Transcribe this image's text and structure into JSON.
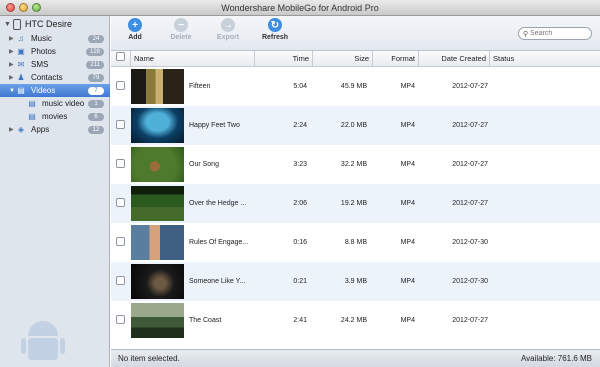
{
  "window": {
    "title": "Wondershare MobileGo for Android Pro"
  },
  "sidebar": {
    "device_name": "HTC Desire",
    "items": [
      {
        "label": "Music",
        "count": "24",
        "icon": "music-note-icon",
        "selected": false,
        "sub": false
      },
      {
        "label": "Photos",
        "count": "128",
        "icon": "photo-icon",
        "selected": false,
        "sub": false
      },
      {
        "label": "SMS",
        "count": "211",
        "icon": "sms-icon",
        "selected": false,
        "sub": false
      },
      {
        "label": "Contacts",
        "count": "79",
        "icon": "contacts-icon",
        "selected": false,
        "sub": false
      },
      {
        "label": "Videos",
        "count": "7",
        "icon": "film-icon",
        "selected": true,
        "sub": false
      },
      {
        "label": "music video",
        "count": "1",
        "icon": "film-icon",
        "selected": false,
        "sub": true
      },
      {
        "label": "movies",
        "count": "6",
        "icon": "film-icon",
        "selected": false,
        "sub": true
      },
      {
        "label": "Apps",
        "count": "12",
        "icon": "apps-icon",
        "selected": false,
        "sub": false
      }
    ]
  },
  "toolbar": {
    "add_label": "Add",
    "delete_label": "Delete",
    "export_label": "Export",
    "refresh_label": "Refresh",
    "search_placeholder": "Search"
  },
  "table": {
    "headers": {
      "name": "Name",
      "time": "Time",
      "size": "Size",
      "format": "Format",
      "date": "Date Created",
      "status": "Status"
    },
    "rows": [
      {
        "name": "Fifteen",
        "time": "5:04",
        "size": "45.9 MB",
        "format": "MP4",
        "date": "2012-07-27",
        "thumb": "video-thumbnail"
      },
      {
        "name": "Happy Feet Two",
        "time": "2:24",
        "size": "22.0 MB",
        "format": "MP4",
        "date": "2012-07-27",
        "thumb": "video-thumbnail"
      },
      {
        "name": "Our Song",
        "time": "3:23",
        "size": "32.2 MB",
        "format": "MP4",
        "date": "2012-07-27",
        "thumb": "video-thumbnail"
      },
      {
        "name": "Over the Hedge ...",
        "time": "2:06",
        "size": "19.2 MB",
        "format": "MP4",
        "date": "2012-07-27",
        "thumb": "video-thumbnail"
      },
      {
        "name": "Rules Of Engage...",
        "time": "0:16",
        "size": "8.8 MB",
        "format": "MP4",
        "date": "2012-07-30",
        "thumb": "video-thumbnail"
      },
      {
        "name": "Someone Like Y...",
        "time": "0:21",
        "size": "3.9 MB",
        "format": "MP4",
        "date": "2012-07-30",
        "thumb": "video-thumbnail"
      },
      {
        "name": "The Coast",
        "time": "2:41",
        "size": "24.2 MB",
        "format": "MP4",
        "date": "2012-07-27",
        "thumb": "video-thumbnail"
      }
    ]
  },
  "statusbar": {
    "left": "No item selected.",
    "right": "Available: 761.6 MB"
  },
  "colors": {
    "accent": "#3f78d0",
    "sidebar_bg": "#dfe5ed",
    "row_alt": "#edf3fb"
  }
}
